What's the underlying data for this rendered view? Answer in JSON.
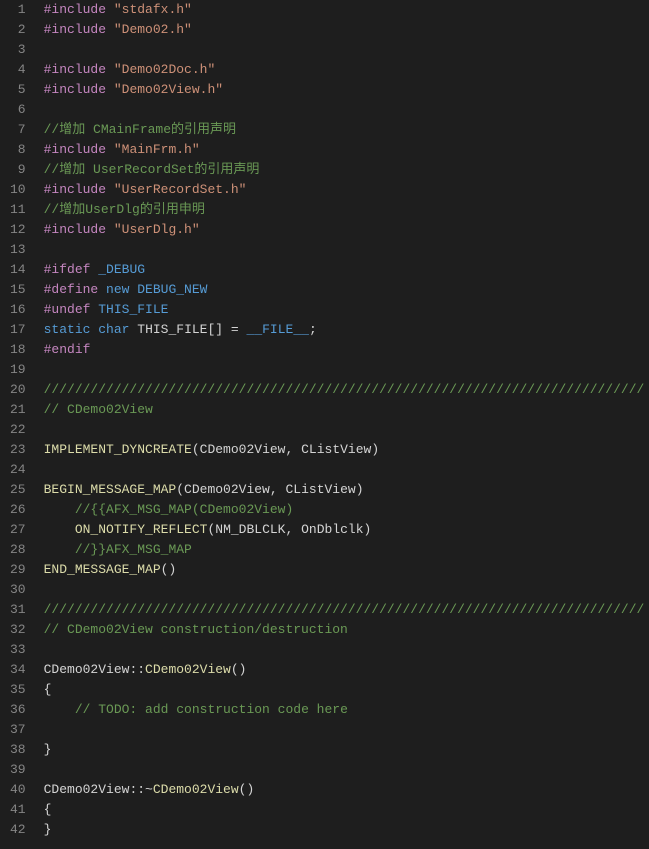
{
  "editor": {
    "theme": "dark",
    "lines": [
      {
        "n": 1,
        "tokens": [
          [
            "pp",
            "#include"
          ],
          [
            "ws",
            " "
          ],
          [
            "str",
            "\"stdafx.h\""
          ]
        ]
      },
      {
        "n": 2,
        "tokens": [
          [
            "pp",
            "#include"
          ],
          [
            "ws",
            " "
          ],
          [
            "str",
            "\"Demo02.h\""
          ]
        ]
      },
      {
        "n": 3,
        "tokens": []
      },
      {
        "n": 4,
        "tokens": [
          [
            "pp",
            "#include"
          ],
          [
            "ws",
            " "
          ],
          [
            "str",
            "\"Demo02Doc.h\""
          ]
        ]
      },
      {
        "n": 5,
        "tokens": [
          [
            "pp",
            "#include"
          ],
          [
            "ws",
            " "
          ],
          [
            "str",
            "\"Demo02View.h\""
          ]
        ]
      },
      {
        "n": 6,
        "tokens": []
      },
      {
        "n": 7,
        "tokens": [
          [
            "cmt",
            "//增加 CMainFrame的引用声明"
          ]
        ]
      },
      {
        "n": 8,
        "tokens": [
          [
            "pp",
            "#include"
          ],
          [
            "ws",
            " "
          ],
          [
            "str",
            "\"MainFrm.h\""
          ]
        ]
      },
      {
        "n": 9,
        "tokens": [
          [
            "cmt",
            "//增加 UserRecordSet的引用声明"
          ]
        ]
      },
      {
        "n": 10,
        "tokens": [
          [
            "pp",
            "#include"
          ],
          [
            "ws",
            " "
          ],
          [
            "str",
            "\"UserRecordSet.h\""
          ]
        ]
      },
      {
        "n": 11,
        "tokens": [
          [
            "cmt",
            "//增加UserDlg的引用申明"
          ]
        ]
      },
      {
        "n": 12,
        "tokens": [
          [
            "pp",
            "#include"
          ],
          [
            "ws",
            " "
          ],
          [
            "str",
            "\"UserDlg.h\""
          ]
        ]
      },
      {
        "n": 13,
        "tokens": []
      },
      {
        "n": 14,
        "tokens": [
          [
            "pp",
            "#ifdef"
          ],
          [
            "ws",
            " "
          ],
          [
            "mac",
            "_DEBUG"
          ]
        ]
      },
      {
        "n": 15,
        "tokens": [
          [
            "pp",
            "#define"
          ],
          [
            "ws",
            " "
          ],
          [
            "mac",
            "new"
          ],
          [
            "ws",
            " "
          ],
          [
            "mac",
            "DEBUG_NEW"
          ]
        ]
      },
      {
        "n": 16,
        "tokens": [
          [
            "pp",
            "#undef"
          ],
          [
            "ws",
            " "
          ],
          [
            "mac",
            "THIS_FILE"
          ]
        ]
      },
      {
        "n": 17,
        "tokens": [
          [
            "kw",
            "static"
          ],
          [
            "ws",
            " "
          ],
          [
            "kw",
            "char"
          ],
          [
            "ws",
            " "
          ],
          [
            "ident",
            "THIS_FILE"
          ],
          [
            "punct",
            "[]"
          ],
          [
            "ws",
            " "
          ],
          [
            "punct",
            "="
          ],
          [
            "ws",
            " "
          ],
          [
            "mac",
            "__FILE__"
          ],
          [
            "punct",
            ";"
          ]
        ]
      },
      {
        "n": 18,
        "tokens": [
          [
            "pp",
            "#endif"
          ]
        ]
      },
      {
        "n": 19,
        "tokens": []
      },
      {
        "n": 20,
        "tokens": [
          [
            "cmt",
            "/////////////////////////////////////////////////////////////////////////////"
          ]
        ]
      },
      {
        "n": 21,
        "tokens": [
          [
            "cmt",
            "// CDemo02View"
          ]
        ]
      },
      {
        "n": 22,
        "tokens": []
      },
      {
        "n": 23,
        "tokens": [
          [
            "func",
            "IMPLEMENT_DYNCREATE"
          ],
          [
            "punct",
            "("
          ],
          [
            "ident",
            "CDemo02View"
          ],
          [
            "punct",
            ","
          ],
          [
            "ws",
            " "
          ],
          [
            "ident",
            "CListView"
          ],
          [
            "punct",
            ")"
          ]
        ]
      },
      {
        "n": 24,
        "tokens": []
      },
      {
        "n": 25,
        "tokens": [
          [
            "func",
            "BEGIN_MESSAGE_MAP"
          ],
          [
            "punct",
            "("
          ],
          [
            "ident",
            "CDemo02View"
          ],
          [
            "punct",
            ","
          ],
          [
            "ws",
            " "
          ],
          [
            "ident",
            "CListView"
          ],
          [
            "punct",
            ")"
          ]
        ]
      },
      {
        "n": 26,
        "tokens": [
          [
            "ws",
            "    "
          ],
          [
            "cmt",
            "//{{AFX_MSG_MAP(CDemo02View)"
          ]
        ]
      },
      {
        "n": 27,
        "tokens": [
          [
            "ws",
            "    "
          ],
          [
            "func",
            "ON_NOTIFY_REFLECT"
          ],
          [
            "punct",
            "("
          ],
          [
            "ident",
            "NM_DBLCLK"
          ],
          [
            "punct",
            ","
          ],
          [
            "ws",
            " "
          ],
          [
            "ident",
            "OnDblclk"
          ],
          [
            "punct",
            ")"
          ]
        ]
      },
      {
        "n": 28,
        "tokens": [
          [
            "ws",
            "    "
          ],
          [
            "cmt",
            "//}}AFX_MSG_MAP"
          ]
        ]
      },
      {
        "n": 29,
        "tokens": [
          [
            "func",
            "END_MESSAGE_MAP"
          ],
          [
            "punct",
            "()"
          ]
        ]
      },
      {
        "n": 30,
        "tokens": []
      },
      {
        "n": 31,
        "tokens": [
          [
            "cmt",
            "/////////////////////////////////////////////////////////////////////////////"
          ]
        ]
      },
      {
        "n": 32,
        "tokens": [
          [
            "cmt",
            "// CDemo02View construction/destruction"
          ]
        ]
      },
      {
        "n": 33,
        "tokens": []
      },
      {
        "n": 34,
        "tokens": [
          [
            "ident",
            "CDemo02View"
          ],
          [
            "punct",
            "::"
          ],
          [
            "func",
            "CDemo02View"
          ],
          [
            "punct",
            "()"
          ]
        ]
      },
      {
        "n": 35,
        "tokens": [
          [
            "punct",
            "{"
          ]
        ]
      },
      {
        "n": 36,
        "tokens": [
          [
            "ws",
            "    "
          ],
          [
            "cmt",
            "// TODO: add construction code here"
          ]
        ]
      },
      {
        "n": 37,
        "tokens": []
      },
      {
        "n": 38,
        "tokens": [
          [
            "punct",
            "}"
          ]
        ]
      },
      {
        "n": 39,
        "tokens": []
      },
      {
        "n": 40,
        "tokens": [
          [
            "ident",
            "CDemo02View"
          ],
          [
            "punct",
            "::~"
          ],
          [
            "func",
            "CDemo02View"
          ],
          [
            "punct",
            "()"
          ]
        ]
      },
      {
        "n": 41,
        "tokens": [
          [
            "punct",
            "{"
          ]
        ]
      },
      {
        "n": 42,
        "tokens": [
          [
            "punct",
            "}"
          ]
        ]
      }
    ]
  }
}
